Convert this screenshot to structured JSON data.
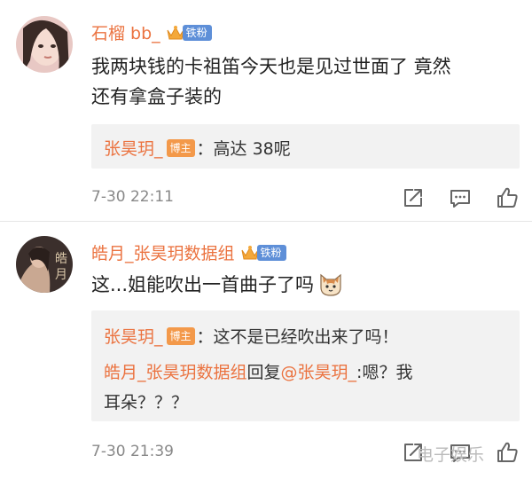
{
  "comments": [
    {
      "username": "石榴 bb_",
      "fan_label": "铁粉",
      "text_line1": "我两块钱的卡祖笛今天也是见过世面了 竟然",
      "text_line2": "还有拿盒子装的",
      "reply": {
        "author": "张昊玥_",
        "blogger_label": "博主",
        "text": "：高达 38呢"
      },
      "timestamp": "7-30 22:11"
    },
    {
      "username": "皓月_张昊玥数据组",
      "fan_label": "铁粉",
      "text": "这...姐能吹出一首曲子了吗",
      "emoji": "cat-face-emoji",
      "replies": [
        {
          "author": "张昊玥_",
          "blogger_label": "博主",
          "text": "：这不是已经吹出来了吗！"
        },
        {
          "author": "皓月_张昊玥数据组",
          "reply_word": "回复",
          "mention": "@张昊玥_",
          "text_line1": ":嗯？我",
          "text_line2": "耳朵？？？"
        }
      ],
      "timestamp": "7-30 21:39"
    }
  ],
  "actions": [
    "share-icon",
    "comment-icon",
    "like-icon"
  ],
  "watermark": "电子娱乐"
}
